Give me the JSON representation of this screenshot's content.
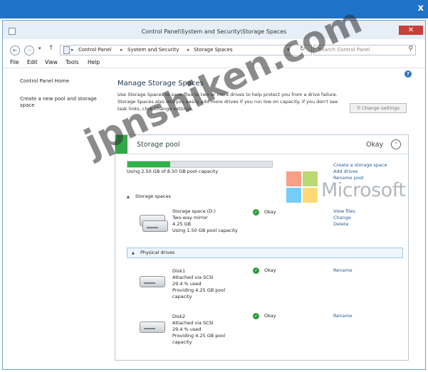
{
  "window": {
    "title": "Control Panel\\System and Security\\Storage Spaces",
    "close_label": "✕",
    "outer_close_label": "x"
  },
  "nav": {
    "back_icon": "arrow-left-icon",
    "forward_icon": "arrow-right-icon",
    "breadcrumb": [
      "Control Panel",
      "System and Security",
      "Storage Spaces"
    ],
    "search_placeholder": "Search Control Panel"
  },
  "menu": [
    "File",
    "Edit",
    "View",
    "Tools",
    "Help"
  ],
  "left_pane": {
    "home": "Control Panel Home",
    "create_pool": "Create a new pool and storage space"
  },
  "main": {
    "heading": "Manage Storage Spaces",
    "description": "Use Storage Spaces to save files to two or more drives to help protect you from a drive failure. Storage Spaces also lets you easily add more drives if you run low on capacity. If you don't see task links, click Change settings.",
    "change_settings": "Change settings"
  },
  "pool": {
    "title": "Storage pool",
    "status": "Okay",
    "usage_text": "Using 2.50 GB of 8.50 GB pool capacity",
    "usage_fraction": 0.294,
    "links": [
      "Create a storage space",
      "Add drives",
      "Rename pool"
    ],
    "storage_spaces_header": "Storage spaces",
    "physical_drives_header": "Physical drives",
    "space": {
      "name": "Storage space (D:)",
      "type": "Two-way mirror",
      "size": "4.25 GB",
      "usage": "Using 1.50 GB pool capacity",
      "status": "Okay",
      "links": [
        "View files",
        "Change",
        "Delete"
      ]
    },
    "disks": [
      {
        "name": "Disk1",
        "attach": "Attached via SCSI",
        "used": "29.4 % used",
        "providing": "Providing 4.25 GB pool",
        "capacity": "capacity",
        "status": "Okay",
        "link": "Rename"
      },
      {
        "name": "Disk2",
        "attach": "Attached via SCSI",
        "used": "29.4 % used",
        "providing": "Providing 4.25 GB pool",
        "capacity": "capacity",
        "status": "Okay",
        "link": "Rename"
      }
    ]
  },
  "overlay": {
    "watermark": "jpnshiken.com",
    "microsoft": "Microsoft",
    "logo_colors": [
      "#f25022",
      "#7fba00",
      "#00a4ef",
      "#ffb900"
    ]
  },
  "colors": {
    "title_band": "#1e73c8",
    "pool_accent": "#32a84a",
    "link": "#245d94"
  }
}
